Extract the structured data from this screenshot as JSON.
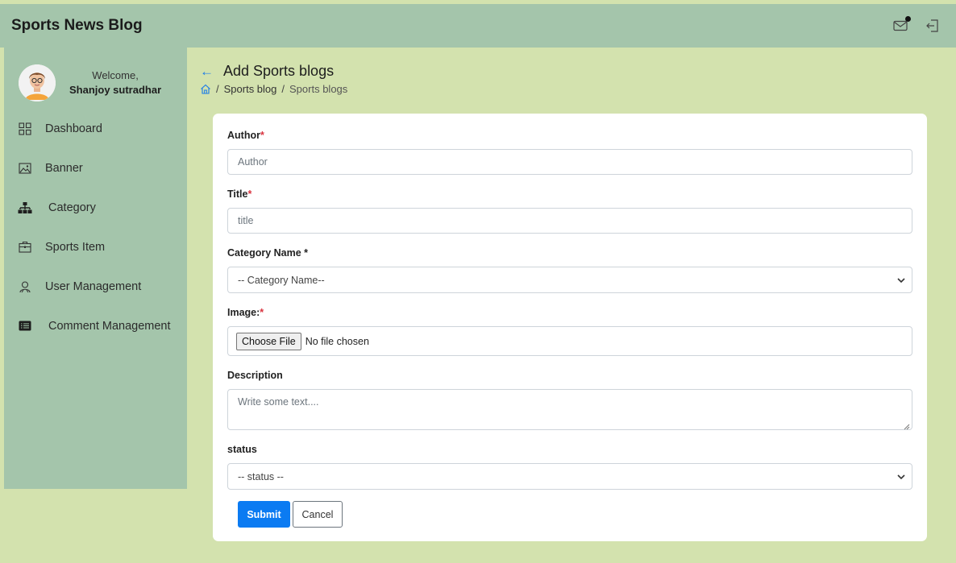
{
  "header": {
    "brand": "Sports News Blog",
    "icons": [
      "mail-icon",
      "logout-icon"
    ]
  },
  "profile": {
    "welcome": "Welcome,",
    "name": "Shanjoy sutradhar"
  },
  "sidebar": {
    "items": [
      {
        "label": "Dashboard",
        "icon": "dashboard-grid-icon"
      },
      {
        "label": "Banner",
        "icon": "image-icon"
      },
      {
        "label": "Category",
        "icon": "hierarchy-icon"
      },
      {
        "label": "Sports Item",
        "icon": "briefcase-icon"
      },
      {
        "label": "User Management",
        "icon": "users-icon"
      },
      {
        "label": "Comment Management",
        "icon": "list-card-icon"
      }
    ]
  },
  "page": {
    "title": "Add Sports blogs",
    "breadcrumb": {
      "link": "Sports blog",
      "separator": "/",
      "current": "Sports blogs"
    }
  },
  "form": {
    "author": {
      "label": "Author",
      "required": "*",
      "placeholder": "Author"
    },
    "title": {
      "label": "Title",
      "required": "*",
      "placeholder": "title"
    },
    "category": {
      "label": "Category Name *",
      "selected": "-- Category Name--"
    },
    "image": {
      "label": "Image:",
      "required": "*",
      "button": "Choose File",
      "status": "No file chosen"
    },
    "description": {
      "label": "Description",
      "placeholder": "Write some text...."
    },
    "status": {
      "label": "status",
      "selected": "-- status --"
    },
    "submit": "Submit",
    "cancel": "Cancel"
  },
  "colors": {
    "page_bg": "#d3e2ae",
    "header_bg": "#a4c5ab",
    "primary": "#0b7bf2",
    "required": "#d9343f"
  }
}
